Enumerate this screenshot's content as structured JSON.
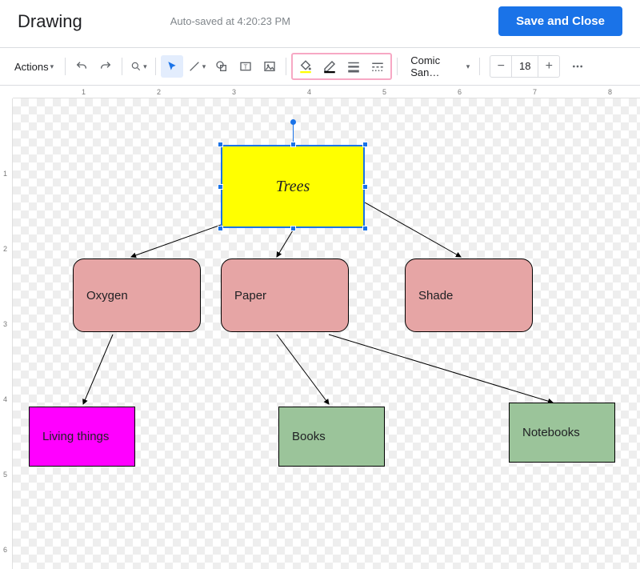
{
  "header": {
    "title": "Drawing",
    "autosave": "Auto-saved at 4:20:23 PM",
    "save_close": "Save and Close"
  },
  "toolbar": {
    "actions_label": "Actions",
    "font_name": "Comic San…",
    "font_size": "18"
  },
  "ruler_h": [
    "1",
    "2",
    "3",
    "4",
    "5",
    "6",
    "7",
    "8"
  ],
  "ruler_v": [
    "1",
    "2",
    "3",
    "4",
    "5",
    "6"
  ],
  "nodes": {
    "root": "Trees",
    "oxygen": "Oxygen",
    "paper": "Paper",
    "shade": "Shade",
    "living": "Living things",
    "books": "Books",
    "notebooks": "Notebooks"
  },
  "colors": {
    "select": "#1a73e8",
    "root_fill": "#ffff00",
    "child_fill": "#e6a5a5",
    "living_fill": "#ff00ff",
    "leaf_fill": "#9bc49a",
    "highlight": "#f7a8c4"
  }
}
